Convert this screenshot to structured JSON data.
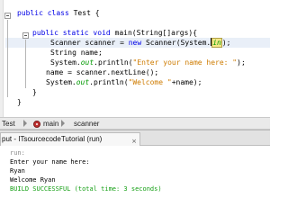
{
  "editor": {
    "lines": [
      {
        "kw": "public class",
        "rest": " Test {"
      },
      {
        "kw": "public static void",
        "method": " main",
        "rest": "(String[]args){"
      },
      {
        "pre": "Scanner scanner = ",
        "kw": "new",
        "rest": " Scanner(System.",
        "field": "in",
        "post": ");"
      },
      {
        "text": "String name;"
      },
      {
        "pre": "System.",
        "field": "out",
        "mid": ".println(",
        "str": "\"Enter your name here: \"",
        "post": ");"
      },
      {
        "text": "name = scanner.nextLine();"
      },
      {
        "pre": "System.",
        "field": "out",
        "mid": ".println(",
        "str": "\"Welcome \"",
        "post": "+name);"
      },
      {
        "text": "}"
      },
      {
        "text": "}"
      }
    ]
  },
  "breadcrumb": {
    "items": [
      "Test",
      "main",
      "scanner"
    ]
  },
  "output": {
    "tab_label": "put - ITsourcecodeTutorial (run)",
    "close_glyph": "×",
    "lines": [
      {
        "text": "run:",
        "kind": "run"
      },
      {
        "text": "Enter your name here:",
        "kind": "std"
      },
      {
        "text": "Ryan",
        "kind": "std"
      },
      {
        "text": "Welcome Ryan",
        "kind": "std"
      },
      {
        "text": "BUILD SUCCESSFUL (total time: 3 seconds)",
        "kind": "success"
      }
    ]
  },
  "colors": {
    "keyword": "#0000e6",
    "string": "#ce7b00",
    "field": "#009900",
    "success": "#16a016"
  }
}
